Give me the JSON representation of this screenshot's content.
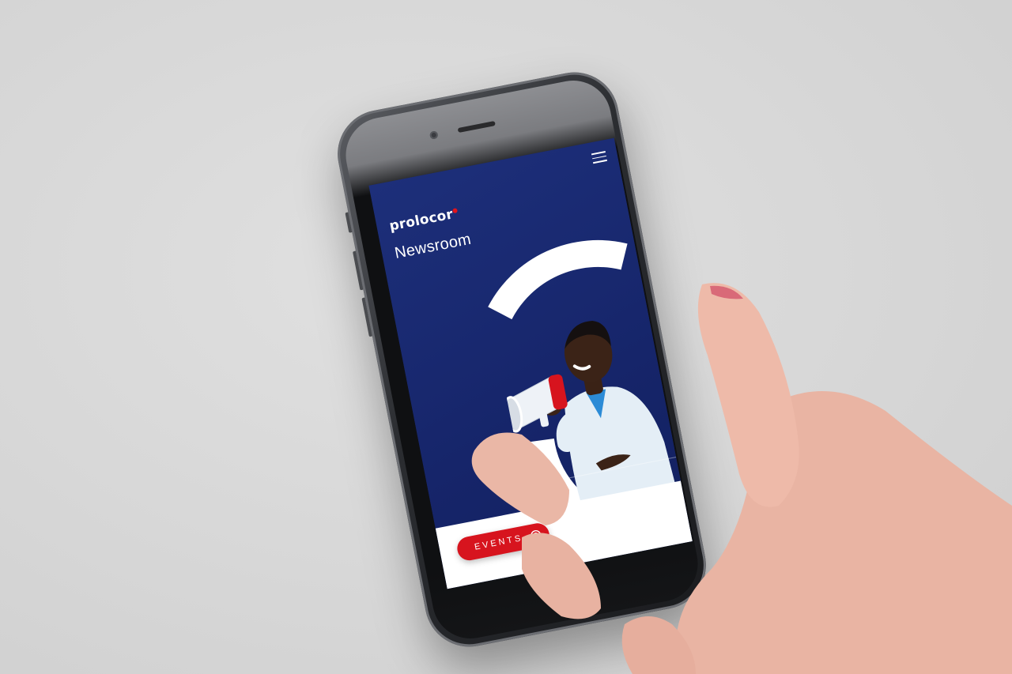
{
  "app": {
    "logo_text": "prolocor",
    "page_title": "Newsroom"
  },
  "header": {
    "menu_icon": "hamburger-menu-icon"
  },
  "cta": {
    "events_label": "EVENTS",
    "events_icon": "target-icon"
  },
  "colors": {
    "brand_blue": "#1b2a6b",
    "accent_red": "#d7141e",
    "white": "#ffffff",
    "backdrop": "#d9d9d9"
  }
}
